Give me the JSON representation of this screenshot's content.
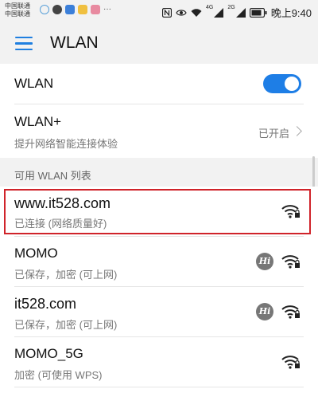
{
  "status_bar": {
    "carrier_1": "中国联通",
    "carrier_2": "中国联通",
    "time": "晚上9:40",
    "network_1": "4G",
    "network_2": "2G"
  },
  "app_bar": {
    "title": "WLAN"
  },
  "wlan_toggle": {
    "label": "WLAN",
    "enabled": true
  },
  "wlan_plus": {
    "label": "WLAN+",
    "description": "提升网络智能连接体验",
    "status": "已开启"
  },
  "network_list": {
    "header": "可用 WLAN 列表",
    "items": [
      {
        "ssid": "www.it528.com",
        "status": "已连接 (网络质量好)",
        "hi": false,
        "locked": true
      },
      {
        "ssid": "MOMO",
        "status": "已保存，加密 (可上网)",
        "hi": true,
        "hi_label": "Hi",
        "locked": true
      },
      {
        "ssid": "it528.com",
        "status": "已保存，加密 (可上网)",
        "hi": true,
        "hi_label": "Hi",
        "locked": true
      },
      {
        "ssid": "MOMO_5G",
        "status": "加密 (可使用 WPS)",
        "hi": false,
        "locked": true
      }
    ]
  },
  "colors": {
    "accent": "#1e7ee6",
    "highlight_border": "#d0232a"
  }
}
